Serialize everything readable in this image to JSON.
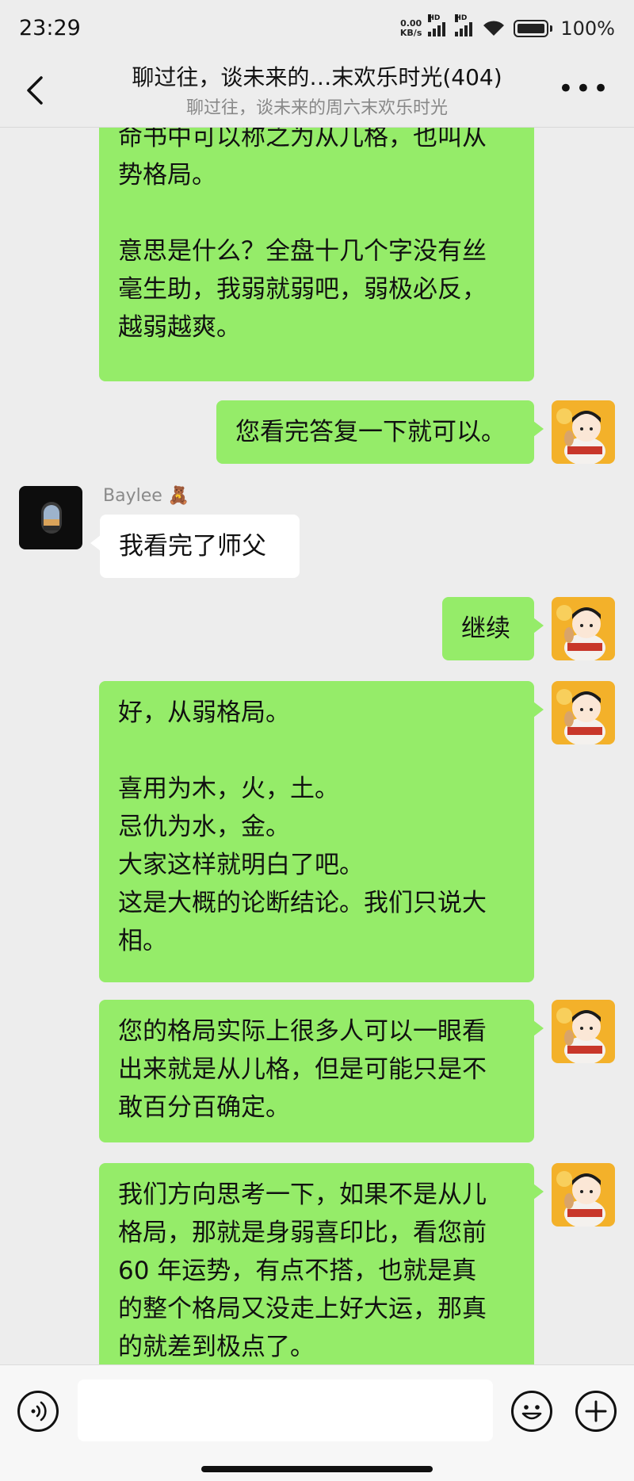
{
  "status": {
    "time": "23:29",
    "net_speed_value": "0.00",
    "net_speed_unit": "KB/s",
    "signal1_label": "HD",
    "signal2_label": "HD",
    "battery": "100%"
  },
  "header": {
    "title": "聊过往，谈未来的…末欢乐时光(404)",
    "subtitle": "聊过往，谈未来的周六末欢乐时光",
    "more": "•••"
  },
  "messages": [
    {
      "from": "me",
      "lines": [
        "命书中可以称之为从儿格，也叫从",
        "势格局。",
        "",
        "意思是什么？全盘十几个字没有丝",
        "毫生助，我弱就弱吧，弱极必反，",
        "越弱越爽。"
      ]
    },
    {
      "from": "me",
      "lines": [
        "您看完答复一下就可以。"
      ]
    },
    {
      "from": "other",
      "sender": "Baylee 🧸",
      "lines": [
        "我看完了师父"
      ]
    },
    {
      "from": "me",
      "lines": [
        "继续"
      ]
    },
    {
      "from": "me",
      "lines": [
        "好，从弱格局。",
        "",
        "喜用为木，火，土。",
        "忌仇为水，金。",
        "大家这样就明白了吧。",
        "这是大概的论断结论。我们只说大",
        "相。"
      ]
    },
    {
      "from": "me",
      "lines": [
        "您的格局实际上很多人可以一眼看",
        "出来就是从儿格，但是可能只是不",
        "敢百分百确定。"
      ]
    },
    {
      "from": "me",
      "lines": [
        "我们方向思考一下，如果不是从儿",
        "格局，那就是身弱喜印比，看您前",
        "60 年运势，有点不搭，也就是真",
        "的整个格局又没走上好大运，那真",
        "的就差到极点了。"
      ]
    }
  ],
  "input": {
    "placeholder": ""
  },
  "colors": {
    "bubble_me": "#95ec69",
    "bubble_other": "#ffffff",
    "background": "#ededed"
  }
}
